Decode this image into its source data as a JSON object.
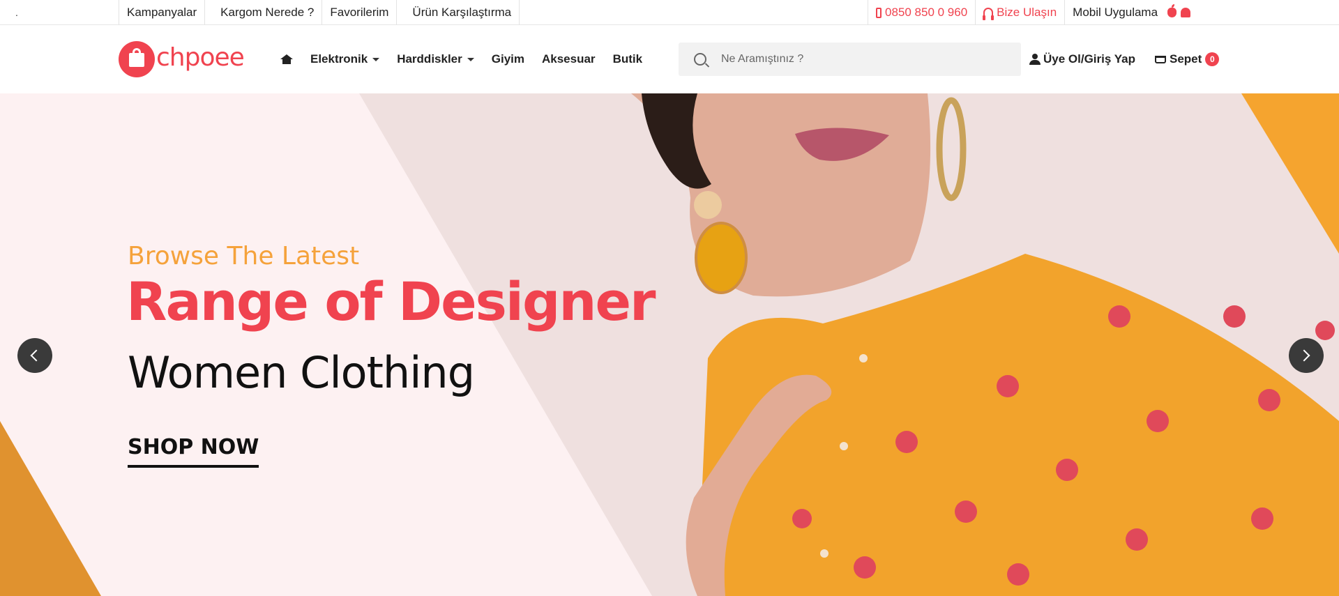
{
  "topbar": {
    "dot": ".",
    "links": [
      "Kampanyalar",
      "Kargom Nerede ?",
      "Favorilerim",
      "Ürün Karşılaştırma"
    ],
    "phone": "0850 850 0 960",
    "contact": "Bize Ulaşın",
    "mobile_app": "Mobil Uygulama",
    "icons": [
      "phone-icon",
      "headset-icon",
      "apple-icon",
      "android-icon"
    ]
  },
  "header": {
    "logo_text": "chpoee",
    "nav": [
      {
        "label": "Elektronik",
        "dropdown": true
      },
      {
        "label": "Harddiskler",
        "dropdown": true
      },
      {
        "label": "Giyim",
        "dropdown": false
      },
      {
        "label": "Aksesuar",
        "dropdown": false
      },
      {
        "label": "Butik",
        "dropdown": false
      }
    ],
    "search_placeholder": "Ne Aramıştınız ?",
    "user_label": "Üye Ol/Giriş Yap",
    "cart_label": "Sepet",
    "cart_count": "0"
  },
  "hero": {
    "kicker": "Browse The Latest",
    "headline": "Range of Designer",
    "headline2": "Women Clothing",
    "cta": "SHOP NOW"
  },
  "colors": {
    "brand": "#f0434f",
    "accent_orange": "#f5a23b",
    "garment": "#f2a32c"
  }
}
